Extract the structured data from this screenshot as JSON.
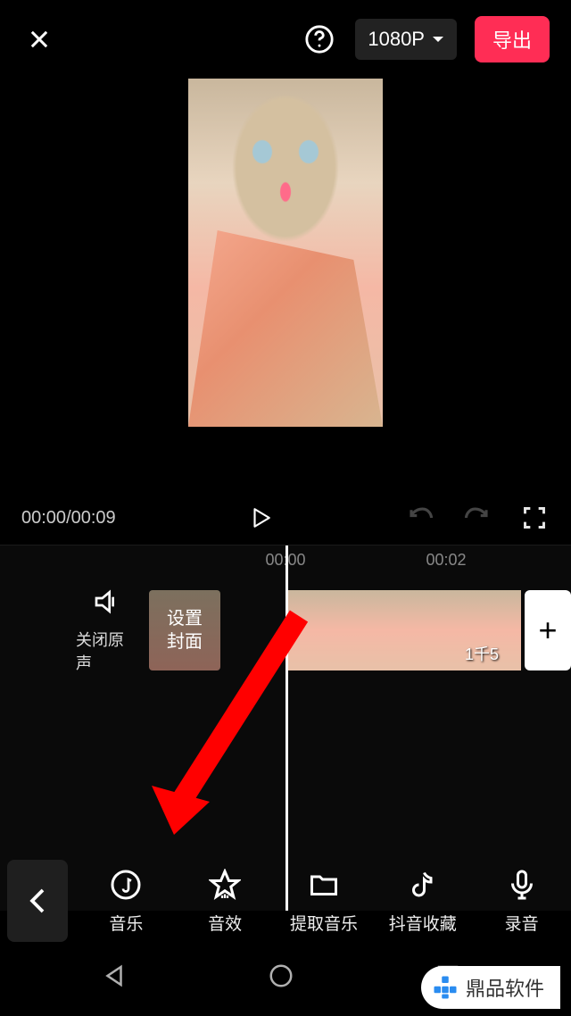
{
  "header": {
    "resolution": "1080P",
    "export_label": "导出"
  },
  "playback": {
    "time_current": "00:00",
    "time_total": "00:09"
  },
  "ruler": {
    "marks": [
      "00:00",
      "00:02"
    ]
  },
  "track_row": {
    "mute_label": "关闭原声",
    "cover_line1": "设置",
    "cover_line2": "封面",
    "clip_text": "1千5",
    "add_label": "+"
  },
  "tools": [
    {
      "id": "music",
      "label": "音乐"
    },
    {
      "id": "sfx",
      "label": "音效"
    },
    {
      "id": "extract",
      "label": "提取音乐"
    },
    {
      "id": "douyin-fav",
      "label": "抖音收藏"
    },
    {
      "id": "record",
      "label": "录音"
    }
  ],
  "watermark": {
    "text": "鼎品软件"
  }
}
